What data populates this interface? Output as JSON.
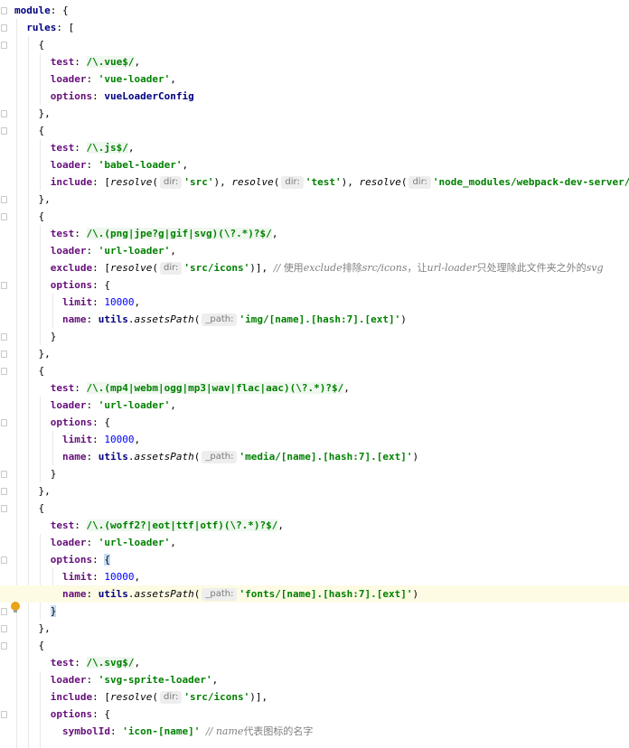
{
  "editor": {
    "colors": {
      "keyword": "#000080",
      "property": "#660e7a",
      "string": "#008000",
      "number": "#0000ff",
      "comment": "#808080",
      "current_line": "#fdfbe4"
    },
    "current_line_index": 34,
    "icons": [
      "lightbulb-icon",
      "fold-marker-icon"
    ],
    "lines": [
      [
        [
          "kw",
          "module"
        ],
        [
          "p",
          ": {"
        ]
      ],
      [
        [
          "p",
          "  "
        ],
        [
          "kw",
          "rules"
        ],
        [
          "p",
          ": ["
        ]
      ],
      [
        [
          "p",
          "    {"
        ]
      ],
      [
        [
          "p",
          "      "
        ],
        [
          "prop",
          "test"
        ],
        [
          "p",
          ": "
        ],
        [
          "re",
          "/\\.vue$/"
        ],
        [
          "p",
          ","
        ]
      ],
      [
        [
          "p",
          "      "
        ],
        [
          "prop",
          "loader"
        ],
        [
          "p",
          ": "
        ],
        [
          "str",
          "'vue-loader'"
        ],
        [
          "p",
          ","
        ]
      ],
      [
        [
          "p",
          "      "
        ],
        [
          "prop",
          "options"
        ],
        [
          "p",
          ": "
        ],
        [
          "id",
          "vueLoaderConfig"
        ]
      ],
      [
        [
          "p",
          "    },"
        ]
      ],
      [
        [
          "p",
          "    {"
        ]
      ],
      [
        [
          "p",
          "      "
        ],
        [
          "prop",
          "test"
        ],
        [
          "p",
          ": "
        ],
        [
          "re",
          "/\\.js$/"
        ],
        [
          "p",
          ","
        ]
      ],
      [
        [
          "p",
          "      "
        ],
        [
          "prop",
          "loader"
        ],
        [
          "p",
          ": "
        ],
        [
          "str",
          "'babel-loader'"
        ],
        [
          "p",
          ","
        ]
      ],
      [
        [
          "p",
          "      "
        ],
        [
          "prop",
          "include"
        ],
        [
          "p",
          ": ["
        ],
        [
          "fn",
          "resolve"
        ],
        [
          "p",
          "("
        ],
        [
          "hint",
          "dir:"
        ],
        [
          "str",
          "'src'"
        ],
        [
          "p",
          "), "
        ],
        [
          "fn",
          "resolve"
        ],
        [
          "p",
          "("
        ],
        [
          "hint",
          "dir:"
        ],
        [
          "str",
          "'test'"
        ],
        [
          "p",
          "), "
        ],
        [
          "fn",
          "resolve"
        ],
        [
          "p",
          "("
        ],
        [
          "hint",
          "dir:"
        ],
        [
          "str",
          "'node_modules/webpack-dev-server/client'"
        ],
        [
          "p",
          ")]"
        ]
      ],
      [
        [
          "p",
          "    },"
        ]
      ],
      [
        [
          "p",
          "    {"
        ]
      ],
      [
        [
          "p",
          "      "
        ],
        [
          "prop",
          "test"
        ],
        [
          "p",
          ": "
        ],
        [
          "re",
          "/\\.(png|jpe?g|gif|svg)(\\?.*)?$/"
        ],
        [
          "p",
          ","
        ]
      ],
      [
        [
          "p",
          "      "
        ],
        [
          "prop",
          "loader"
        ],
        [
          "p",
          ": "
        ],
        [
          "str",
          "'url-loader'"
        ],
        [
          "p",
          ","
        ]
      ],
      [
        [
          "p",
          "      "
        ],
        [
          "prop",
          "exclude"
        ],
        [
          "p",
          ": ["
        ],
        [
          "fn",
          "resolve"
        ],
        [
          "p",
          "("
        ],
        [
          "hint",
          "dir:"
        ],
        [
          "str",
          "'src/icons'"
        ],
        [
          "p",
          ")], "
        ],
        [
          "cmt",
          "// "
        ],
        [
          "cmtcj",
          "使用"
        ],
        [
          "cmt",
          "exclude"
        ],
        [
          "cmtcj",
          "排除"
        ],
        [
          "cmt",
          "src/icons"
        ],
        [
          "cmtcj",
          "，让"
        ],
        [
          "cmt",
          "url-loader"
        ],
        [
          "cmtcj",
          "只处理除此文件夹之外的"
        ],
        [
          "cmt",
          "svg"
        ]
      ],
      [
        [
          "p",
          "      "
        ],
        [
          "prop",
          "options"
        ],
        [
          "p",
          ": {"
        ]
      ],
      [
        [
          "p",
          "        "
        ],
        [
          "prop",
          "limit"
        ],
        [
          "p",
          ": "
        ],
        [
          "num",
          "10000"
        ],
        [
          "p",
          ","
        ]
      ],
      [
        [
          "p",
          "        "
        ],
        [
          "prop",
          "name"
        ],
        [
          "p",
          ": "
        ],
        [
          "id",
          "utils"
        ],
        [
          "p",
          "."
        ],
        [
          "fn",
          "assetsPath"
        ],
        [
          "p",
          "("
        ],
        [
          "hint",
          "_path:"
        ],
        [
          "str",
          "'img/[name].[hash:7].[ext]'"
        ],
        [
          "p",
          ")"
        ]
      ],
      [
        [
          "p",
          "      }"
        ]
      ],
      [
        [
          "p",
          "    },"
        ]
      ],
      [
        [
          "p",
          "    {"
        ]
      ],
      [
        [
          "p",
          "      "
        ],
        [
          "prop",
          "test"
        ],
        [
          "p",
          ": "
        ],
        [
          "re",
          "/\\.(mp4|webm|ogg|mp3|wav|flac|aac)(\\?.*)?$/"
        ],
        [
          "p",
          ","
        ]
      ],
      [
        [
          "p",
          "      "
        ],
        [
          "prop",
          "loader"
        ],
        [
          "p",
          ": "
        ],
        [
          "str",
          "'url-loader'"
        ],
        [
          "p",
          ","
        ]
      ],
      [
        [
          "p",
          "      "
        ],
        [
          "prop",
          "options"
        ],
        [
          "p",
          ": {"
        ]
      ],
      [
        [
          "p",
          "        "
        ],
        [
          "prop",
          "limit"
        ],
        [
          "p",
          ": "
        ],
        [
          "num",
          "10000"
        ],
        [
          "p",
          ","
        ]
      ],
      [
        [
          "p",
          "        "
        ],
        [
          "prop",
          "name"
        ],
        [
          "p",
          ": "
        ],
        [
          "id",
          "utils"
        ],
        [
          "p",
          "."
        ],
        [
          "fn",
          "assetsPath"
        ],
        [
          "p",
          "("
        ],
        [
          "hint",
          "_path:"
        ],
        [
          "str",
          "'media/[name].[hash:7].[ext]'"
        ],
        [
          "p",
          ")"
        ]
      ],
      [
        [
          "p",
          "      }"
        ]
      ],
      [
        [
          "p",
          "    },"
        ]
      ],
      [
        [
          "p",
          "    {"
        ]
      ],
      [
        [
          "p",
          "      "
        ],
        [
          "prop",
          "test"
        ],
        [
          "p",
          ": "
        ],
        [
          "re",
          "/\\.(woff2?|eot|ttf|otf)(\\?.*)?$/"
        ],
        [
          "p",
          ","
        ]
      ],
      [
        [
          "p",
          "      "
        ],
        [
          "prop",
          "loader"
        ],
        [
          "p",
          ": "
        ],
        [
          "str",
          "'url-loader'"
        ],
        [
          "p",
          ","
        ]
      ],
      [
        [
          "p",
          "      "
        ],
        [
          "prop",
          "options"
        ],
        [
          "p",
          ": "
        ],
        [
          "hl",
          "{"
        ]
      ],
      [
        [
          "p",
          "        "
        ],
        [
          "prop",
          "limit"
        ],
        [
          "p",
          ": "
        ],
        [
          "num",
          "10000"
        ],
        [
          "p",
          ","
        ]
      ],
      [
        [
          "p",
          "        "
        ],
        [
          "prop",
          "name"
        ],
        [
          "p",
          ": "
        ],
        [
          "id",
          "utils"
        ],
        [
          "p",
          "."
        ],
        [
          "fn",
          "assetsPath"
        ],
        [
          "p",
          "("
        ],
        [
          "hint",
          "_path:"
        ],
        [
          "str",
          "'fonts/[name].[hash:7].[ext]'"
        ],
        [
          "p",
          ")"
        ]
      ],
      [
        [
          "p",
          "      "
        ],
        [
          "hl",
          "}"
        ]
      ],
      [
        [
          "p",
          "    },"
        ]
      ],
      [
        [
          "p",
          "    {"
        ]
      ],
      [
        [
          "p",
          "      "
        ],
        [
          "prop",
          "test"
        ],
        [
          "p",
          ": "
        ],
        [
          "re",
          "/\\.svg$/"
        ],
        [
          "p",
          ","
        ]
      ],
      [
        [
          "p",
          "      "
        ],
        [
          "prop",
          "loader"
        ],
        [
          "p",
          ": "
        ],
        [
          "str",
          "'svg-sprite-loader'"
        ],
        [
          "p",
          ","
        ]
      ],
      [
        [
          "p",
          "      "
        ],
        [
          "prop",
          "include"
        ],
        [
          "p",
          ": ["
        ],
        [
          "fn",
          "resolve"
        ],
        [
          "p",
          "("
        ],
        [
          "hint",
          "dir:"
        ],
        [
          "str",
          "'src/icons'"
        ],
        [
          "p",
          ")],"
        ]
      ],
      [
        [
          "p",
          "      "
        ],
        [
          "prop",
          "options"
        ],
        [
          "p",
          ": {"
        ]
      ],
      [
        [
          "p",
          "        "
        ],
        [
          "prop",
          "symbolId"
        ],
        [
          "p",
          ": "
        ],
        [
          "str",
          "'icon-[name]'"
        ],
        [
          "p",
          " "
        ],
        [
          "cmt",
          "// name"
        ],
        [
          "cmtcj",
          "代表图标的名字"
        ]
      ]
    ]
  }
}
